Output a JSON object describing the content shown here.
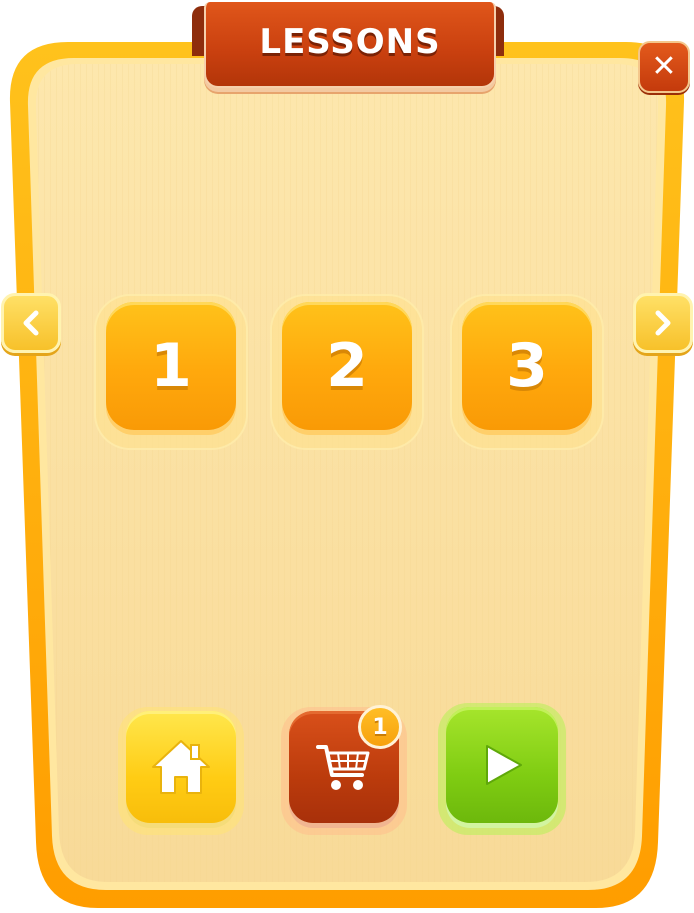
{
  "header": {
    "title": "LESSONS"
  },
  "icons": {
    "close": "close-icon",
    "prev": "chevron-left-icon",
    "next": "chevron-right-icon",
    "home": "home-icon",
    "shop": "cart-icon",
    "play": "play-icon"
  },
  "lessons": [
    {
      "label": "1"
    },
    {
      "label": "2"
    },
    {
      "label": "3"
    }
  ],
  "shop": {
    "badge_count": "1"
  },
  "colors": {
    "panel_frame": "#ffa800",
    "panel_fill": "#fbe3a4",
    "banner": "#c9400f",
    "tile": "#ffb012",
    "home_button": "#ffd21a",
    "shop_button": "#bb3b0c",
    "play_button": "#7fcc12"
  }
}
